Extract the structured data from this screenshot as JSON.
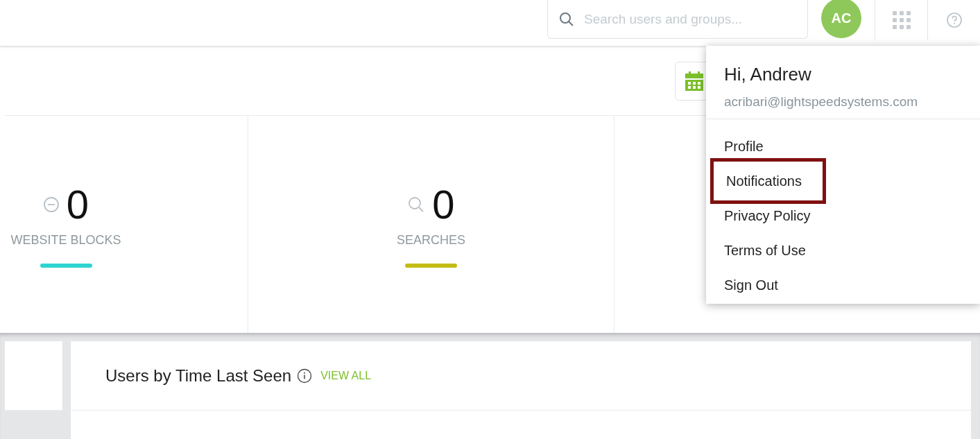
{
  "search": {
    "placeholder": "Search users and groups..."
  },
  "avatar": {
    "initials": "AC"
  },
  "stats": [
    {
      "kind": "blocks",
      "value": "0",
      "label": "WEBSITE BLOCKS",
      "color": "#2ed4d0"
    },
    {
      "kind": "searches",
      "value": "0",
      "label": "SEARCHES",
      "color": "#c4bd14"
    }
  ],
  "panel": {
    "title": "Users by Time Last Seen",
    "link": "VIEW ALL"
  },
  "user_menu": {
    "greeting": "Hi, Andrew",
    "email": "acribari@lightspeedsystems.com",
    "items": [
      {
        "label": "Profile",
        "highlighted": false
      },
      {
        "label": "Notifications",
        "highlighted": true
      },
      {
        "label": "Privacy Policy",
        "highlighted": false
      },
      {
        "label": "Terms of Use",
        "highlighted": false
      },
      {
        "label": "Sign Out",
        "highlighted": false
      }
    ]
  }
}
